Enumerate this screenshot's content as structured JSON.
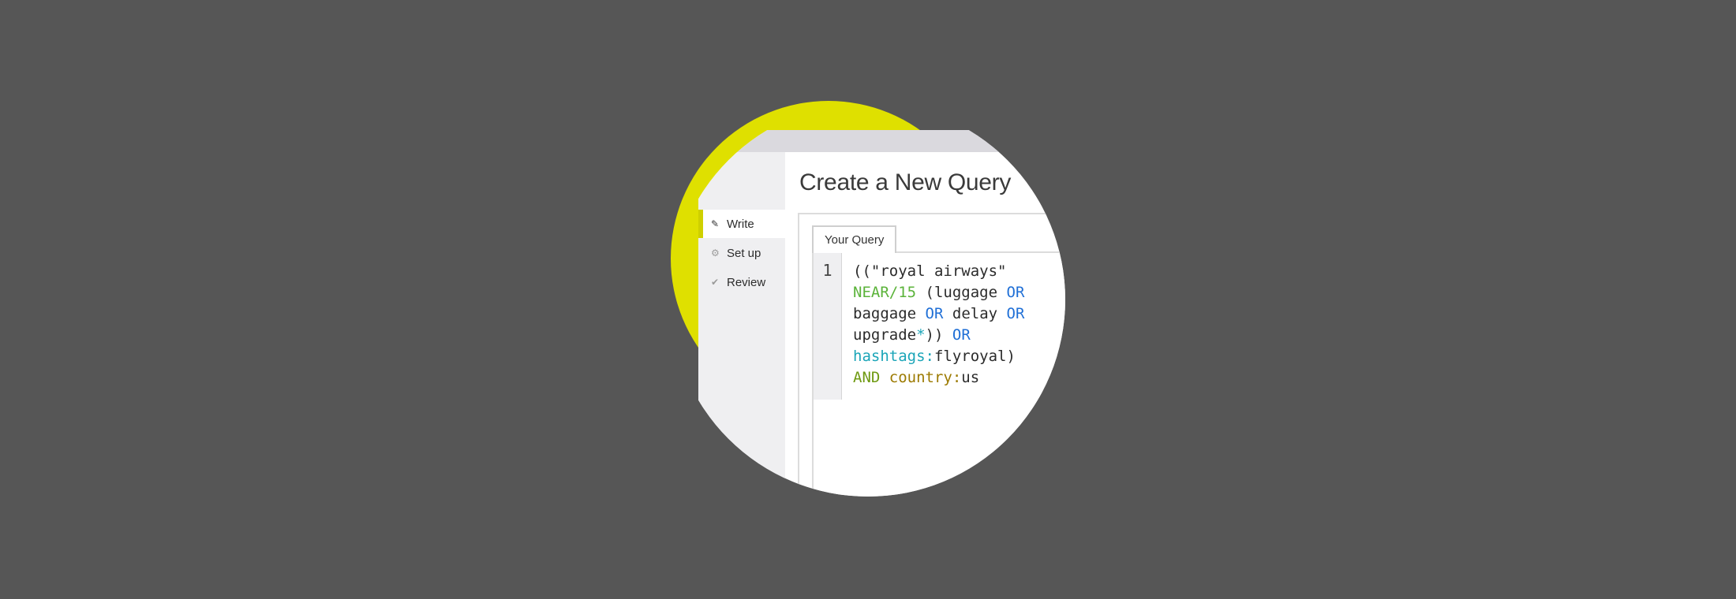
{
  "window": {
    "title_dots": [
      "close",
      "minimize",
      "maximize"
    ]
  },
  "sidebar": {
    "items": [
      {
        "label": "Write",
        "icon": "pencil-icon",
        "active": true
      },
      {
        "label": "Set up",
        "icon": "gear-icon",
        "active": false
      },
      {
        "label": "Review",
        "icon": "check-icon",
        "active": false
      }
    ]
  },
  "main": {
    "title": "Create a New Query",
    "tab_label": "Your Query",
    "line_number": "1",
    "query_tokens": [
      "((\"royal airways\"",
      "NEAR/15",
      "(luggage",
      "OR",
      "baggage",
      "OR",
      "delay",
      "OR",
      "upgrade",
      "*",
      "))",
      "OR",
      "hashtags:",
      "flyroyal)",
      "AND",
      "country:",
      "us"
    ]
  },
  "colors": {
    "background": "#565656",
    "accent_yellow": "#dfe000",
    "keyword_green": "#5bb33a",
    "operator_blue": "#1f6fd6",
    "tag_teal": "#1ba5b8",
    "field_olive": "#9c7a00"
  }
}
